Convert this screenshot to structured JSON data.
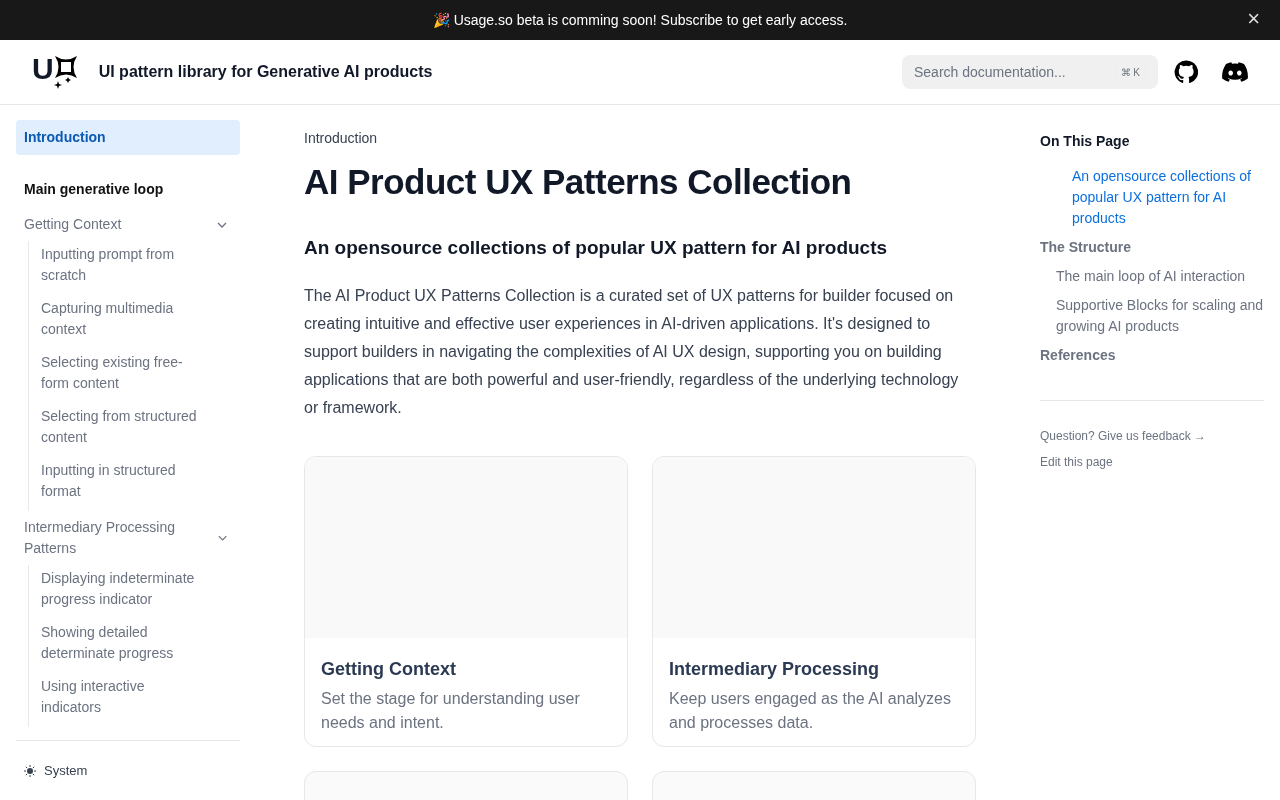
{
  "banner": {
    "emoji": "🎉",
    "text": "Usage.so beta is comming soon! Subscribe to get early access.",
    "close": "×"
  },
  "header": {
    "logo_text": "U",
    "title": "UI pattern library for Generative AI products",
    "search": {
      "placeholder": "Search documentation...",
      "shortcut": "⌘ K"
    }
  },
  "sidebar": {
    "items": [
      {
        "kind": "link",
        "label": "Introduction",
        "selected": true
      },
      {
        "kind": "section",
        "label": "Main generative loop"
      },
      {
        "kind": "group",
        "label": "Getting Context",
        "expanded": true,
        "children": [
          {
            "label": "Inputting prompt from scratch",
            "selected": false
          },
          {
            "label": "Capturing multimedia context",
            "selected": false
          },
          {
            "label": "Selecting existing free-form content",
            "selected": false
          },
          {
            "label": "Selecting from structured content",
            "selected": false
          },
          {
            "label": "Inputting in structured format",
            "selected": false
          }
        ]
      },
      {
        "kind": "group",
        "label": "Intermediary Processing Patterns",
        "expanded": true,
        "children": [
          {
            "label": "Displaying indeterminate progress indicator",
            "selected": false
          },
          {
            "label": "Showing detailed determinate progress",
            "selected": false
          },
          {
            "label": "Using interactive indicators",
            "selected": false
          }
        ]
      }
    ],
    "theme": "System"
  },
  "main": {
    "breadcrumb": "Introduction",
    "title": "AI Product UX Patterns Collection",
    "subtitle": "An opensource collections of popular UX pattern for AI products",
    "paragraph": "The AI Product UX Patterns Collection is a curated set of UX patterns for builder focused on creating intuitive and effective user experiences in AI-driven applications. It's designed to support builders in navigating the complexities of AI UX design, supporting you on building applications that are both powerful and user-friendly, regardless of the underlying technology or framework.",
    "cards": [
      {
        "kind": "full",
        "title": "Getting Context",
        "description": "Set the stage for understanding user needs and intent."
      },
      {
        "kind": "full",
        "title": "Intermediary Processing",
        "description": "Keep users engaged as the AI analyzes and processes data."
      },
      {
        "kind": "partial"
      },
      {
        "kind": "partial"
      }
    ]
  },
  "toc": {
    "title": "On This Page",
    "items": [
      {
        "kind": "subheading",
        "label": "An opensource collections of popular UX pattern for AI products",
        "selected": true
      },
      {
        "kind": "heading",
        "label": "The Structure",
        "selected": false,
        "children": [
          {
            "label": "The main loop of AI interaction",
            "selected": false
          },
          {
            "label": "Supportive Blocks for scaling and growing AI products",
            "selected": false
          }
        ]
      },
      {
        "kind": "heading",
        "label": "References",
        "selected": false
      }
    ],
    "feedback": "Question? Give us feedback →",
    "edit": "Edit this page"
  }
}
